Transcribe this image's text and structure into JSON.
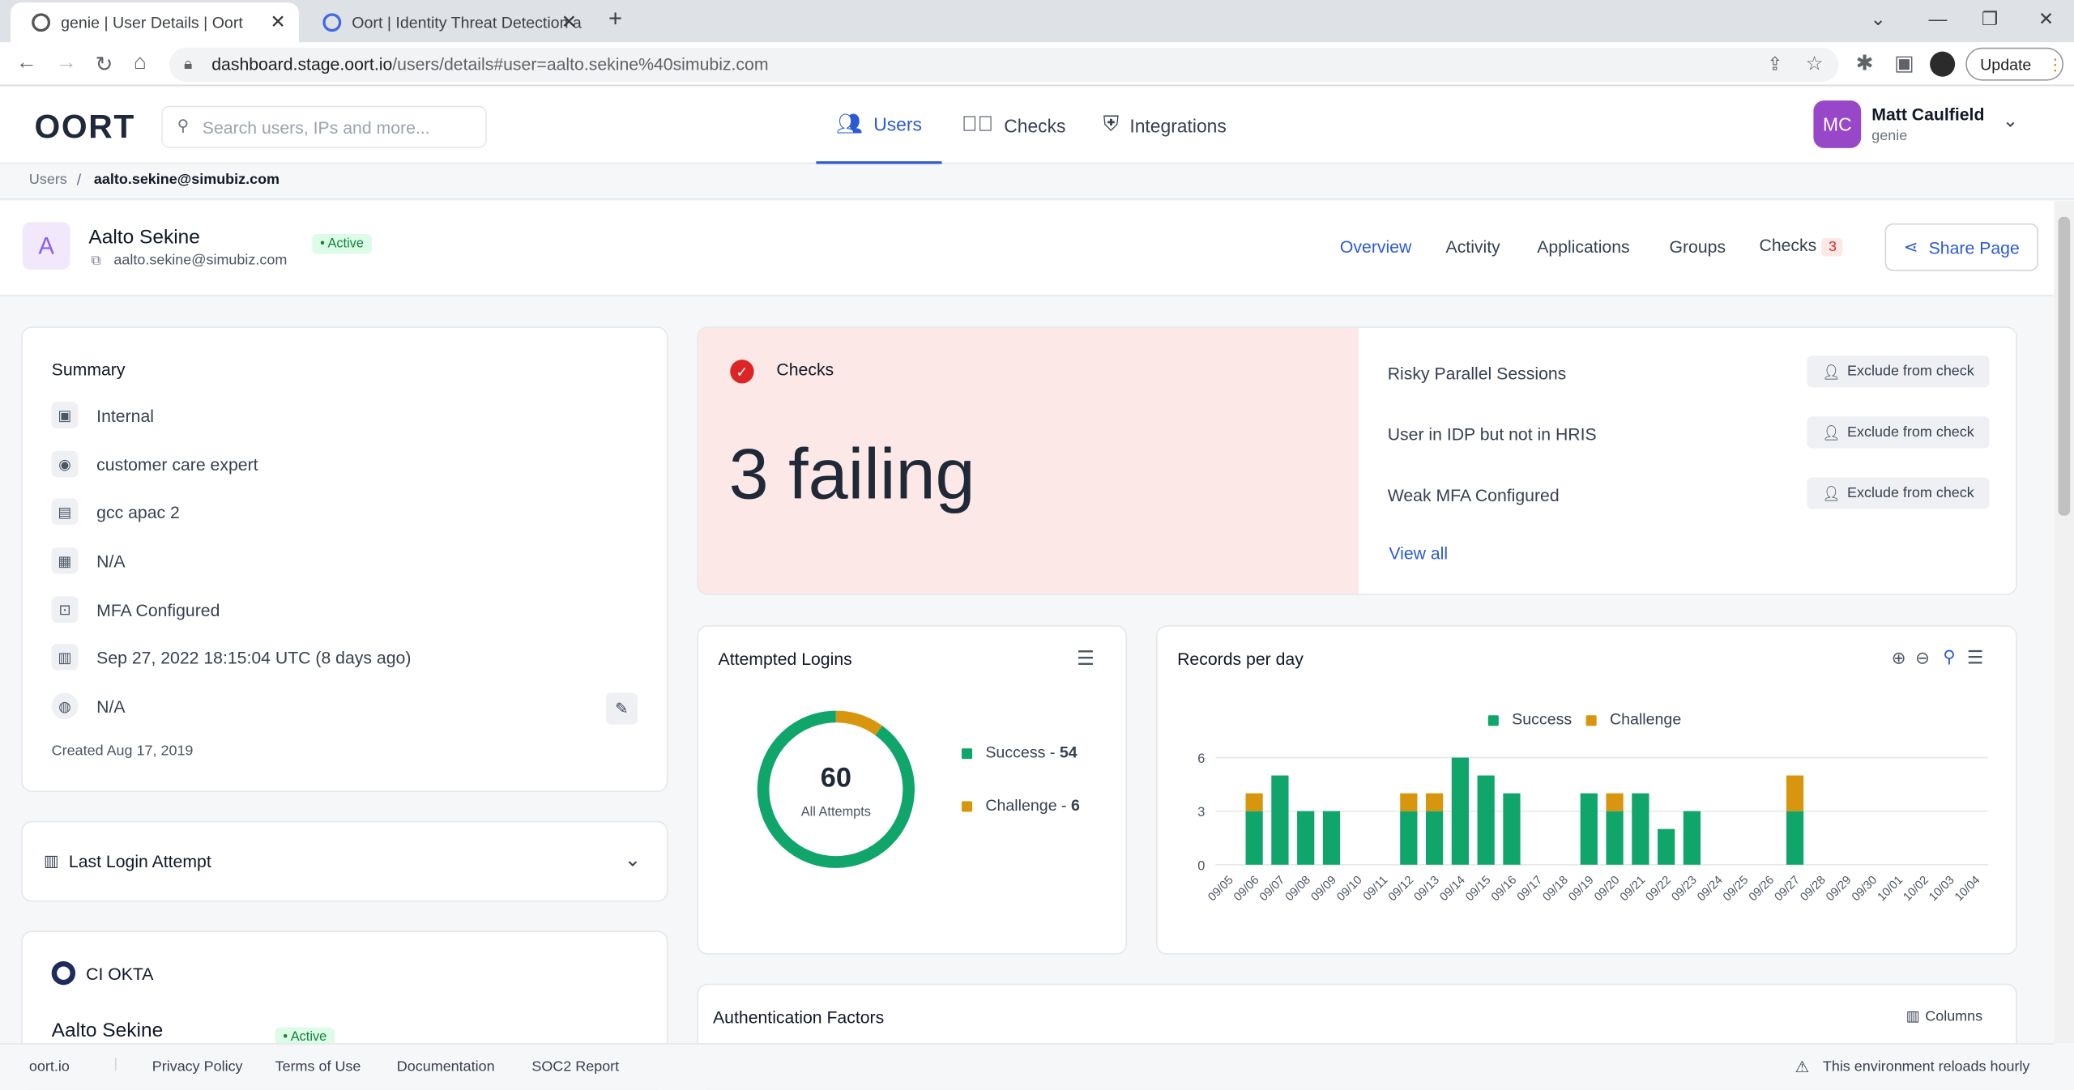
{
  "browser": {
    "tabs": [
      {
        "title": "genie | User Details | Oort"
      },
      {
        "title": "Oort | Identity Threat Detection a"
      }
    ],
    "url_host": "dashboard.stage.oort.io",
    "url_path": "/users/details#user=aalto.sekine%40simubiz.com",
    "update_label": "Update"
  },
  "header": {
    "logo": "OORT",
    "search_placeholder": "Search users, IPs and more...",
    "nav": [
      {
        "label": "Users",
        "icon": "users-icon"
      },
      {
        "label": "Checks",
        "icon": "check-circle-icon"
      },
      {
        "label": "Integrations",
        "icon": "shield-plus-icon"
      }
    ],
    "user": {
      "initials": "MC",
      "name": "Matt Caulfield",
      "org": "genie"
    }
  },
  "breadcrumb": {
    "root": "Users",
    "current": "aalto.sekine@simubiz.com"
  },
  "profile": {
    "avatar": "A",
    "name": "Aalto Sekine",
    "email": "aalto.sekine@simubiz.com",
    "status": "• Active",
    "tabs": [
      "Overview",
      "Activity",
      "Applications",
      "Groups",
      "Checks"
    ],
    "checks_count": "3",
    "share_label": "Share Page"
  },
  "summary": {
    "title": "Summary",
    "rows": [
      "Internal",
      "customer care expert",
      "gcc apac 2",
      "N/A",
      "MFA Configured",
      "Sep 27, 2022 18:15:04 UTC (8 days ago)",
      "N/A"
    ],
    "created": "Created Aug 17, 2019"
  },
  "last_login": {
    "title": "Last Login Attempt"
  },
  "okta": {
    "title": "CI OKTA",
    "name": "Aalto Sekine",
    "status": "• Active"
  },
  "checks": {
    "title": "Checks",
    "big": "3 failing",
    "items": [
      "Risky Parallel Sessions",
      "User in IDP but not in HRIS",
      "Weak MFA Configured"
    ],
    "exclude_label": "Exclude from check",
    "view_all": "View all"
  },
  "logins": {
    "title": "Attempted Logins",
    "total": "60",
    "total_label": "All Attempts",
    "legend": [
      {
        "name": "Success",
        "value": "54"
      },
      {
        "name": "Challenge",
        "value": "6"
      }
    ],
    "colors": {
      "success": "#10a56b",
      "challenge": "#d8960f"
    }
  },
  "chart_data": {
    "type": "bar",
    "title": "Records per day",
    "stacked": true,
    "categories": [
      "09/05",
      "09/06",
      "09/07",
      "09/08",
      "09/09",
      "09/10",
      "09/11",
      "09/12",
      "09/13",
      "09/14",
      "09/15",
      "09/16",
      "09/17",
      "09/18",
      "09/19",
      "09/20",
      "09/21",
      "09/22",
      "09/23",
      "09/24",
      "09/25",
      "09/26",
      "09/27",
      "09/28",
      "09/29",
      "09/30",
      "10/01",
      "10/02",
      "10/03",
      "10/04"
    ],
    "series": [
      {
        "name": "Success",
        "values": [
          0,
          3,
          5,
          3,
          3,
          0,
          0,
          3,
          3,
          6,
          5,
          4,
          0,
          0,
          4,
          3,
          4,
          2,
          3,
          0,
          0,
          0,
          3,
          0,
          0,
          0,
          0,
          0,
          0,
          0
        ]
      },
      {
        "name": "Challenge",
        "values": [
          0,
          1,
          0,
          0,
          0,
          0,
          0,
          1,
          1,
          0,
          0,
          0,
          0,
          0,
          0,
          1,
          0,
          0,
          0,
          0,
          0,
          0,
          2,
          0,
          0,
          0,
          0,
          0,
          0,
          0
        ]
      }
    ],
    "yticks": [
      0,
      3,
      6
    ],
    "ylim": [
      0,
      6
    ],
    "legend": "top-center"
  },
  "auth": {
    "title": "Authentication Factors",
    "columns_label": "Columns"
  },
  "footer": {
    "links": [
      "oort.io",
      "Privacy Policy",
      "Terms of Use",
      "Documentation",
      "SOC2 Report"
    ],
    "notice": "This environment reloads hourly"
  }
}
